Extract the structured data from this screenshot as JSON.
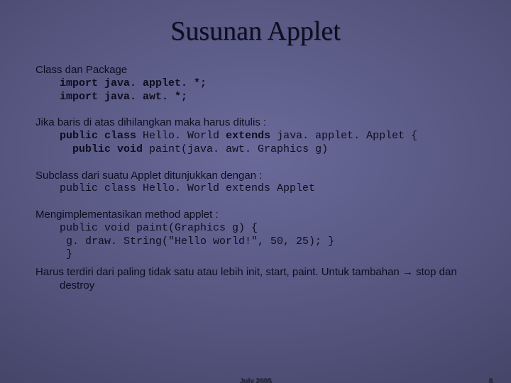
{
  "title": "Susunan Applet",
  "section1": {
    "heading": "Class dan Package",
    "code1": "import java. applet. *;",
    "code2": "import java. awt. *;"
  },
  "section2": {
    "heading": "Jika baris di atas dihilangkan maka harus ditulis :",
    "code1a": "public class ",
    "code1b": "Hello. World ",
    "code1c": "extends ",
    "code1d": "java. applet. Applet {",
    "code2a": "  public void ",
    "code2b": "paint(java. awt. Graphics g)"
  },
  "section3": {
    "heading": "Subclass dari suatu Applet ditunjukkan dengan :",
    "code1": "public class Hello. World extends Applet"
  },
  "section4": {
    "heading": "Mengimplementasikan method applet :",
    "code1": "public void paint(Graphics g) {",
    "code2": " g. draw. String(\"Hello world!\", 50, 25); }",
    "code3": " }"
  },
  "section5": {
    "text": "Harus terdiri dari paling tidak satu atau lebih init, start, paint. Untuk tambahan → stop dan destroy"
  },
  "footer": {
    "date": "July 2005",
    "slideNumber": "8"
  }
}
